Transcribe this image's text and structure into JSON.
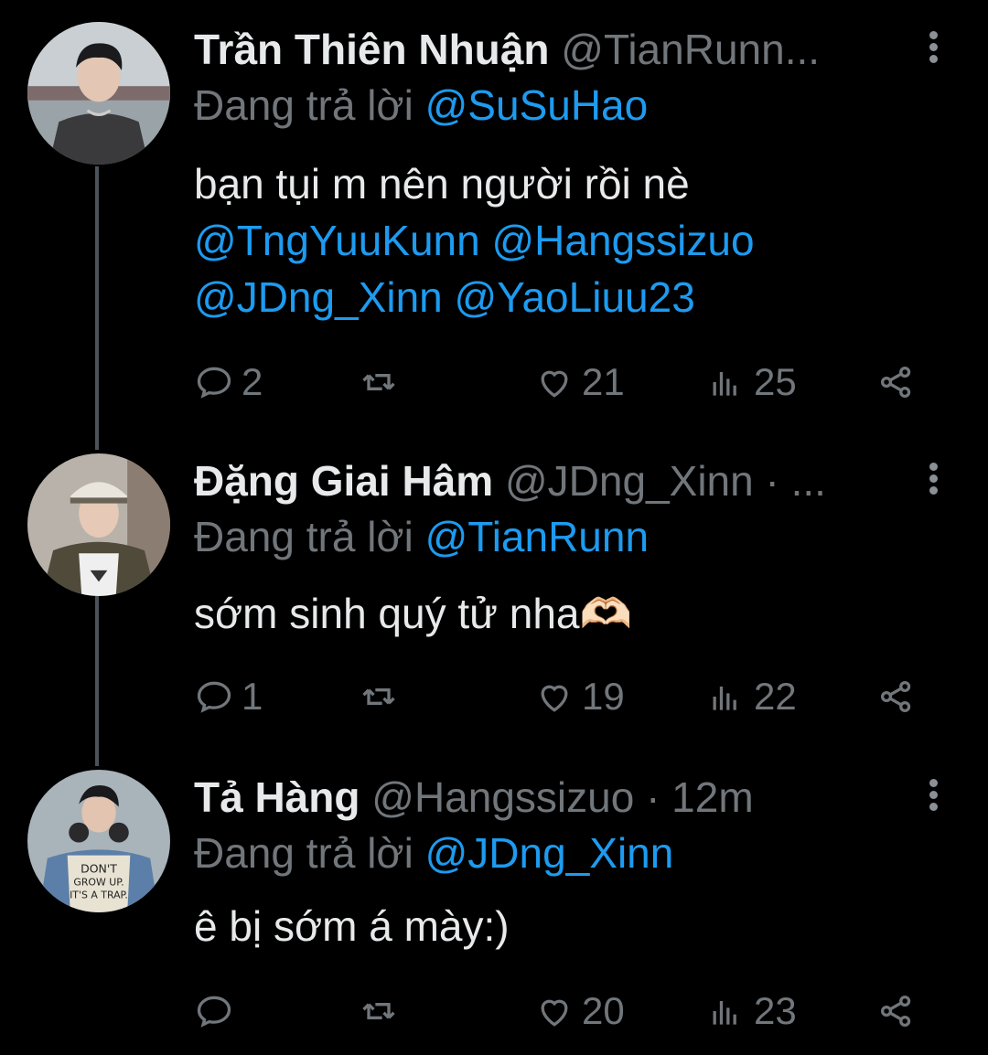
{
  "tweets": [
    {
      "name": "Trần Thiên Nhuận",
      "handle": "@TianRunn...",
      "replying_label": "Đang trả lời",
      "replying_to": "@SuSuHao",
      "text_plain": "bạn tụi m nên người rồi nè",
      "mentions_line1": "@TngYuuKunn @Hangssizuo",
      "mentions_line2": "@JDng_Xinn @YaoLiuu23",
      "replies": "2",
      "retweets": "",
      "likes": "21",
      "views": "25"
    },
    {
      "name": "Đặng Giai Hâm",
      "handle": "@JDng_Xinn · ...",
      "replying_label": "Đang trả lời",
      "replying_to": "@TianRunn",
      "text_plain": "sớm sinh quý tử nha🫶🏻",
      "replies": "1",
      "retweets": "",
      "likes": "19",
      "views": "22"
    },
    {
      "name": "Tả Hàng",
      "handle": "@Hangssizuo · 12m",
      "replying_label": "Đang trả lời",
      "replying_to": "@JDng_Xinn",
      "text_plain": "ê bị sớm á mày:)",
      "replies": "",
      "retweets": "",
      "likes": "20",
      "views": "23"
    }
  ],
  "avatar_shirt_text": "DON'T GROW UP. IT'S A TRAP.",
  "colors": {
    "background": "#000000",
    "text": "#e7e9ea",
    "secondary": "#71767b",
    "link": "#1d9bf0",
    "thread_line": "#4b5259"
  },
  "icons": [
    "reply-icon",
    "retweet-icon",
    "like-icon",
    "views-icon",
    "share-icon",
    "more-icon"
  ]
}
